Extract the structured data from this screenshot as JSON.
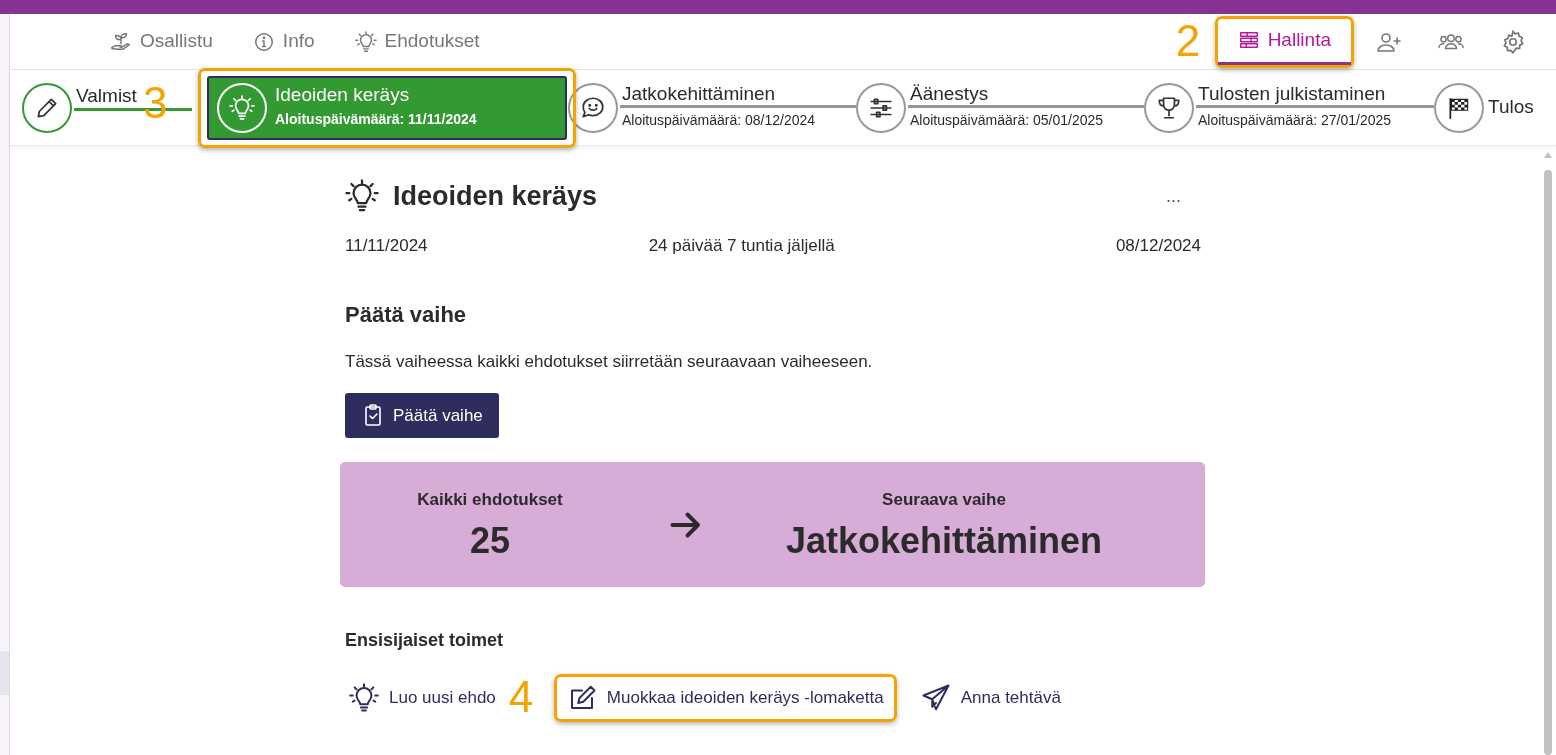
{
  "nav": {
    "items": [
      {
        "label": "Osallistu",
        "selected": false
      },
      {
        "label": "Info",
        "selected": false
      },
      {
        "label": "Ehdotukset",
        "selected": false
      }
    ],
    "admin": {
      "label": "Hallinta",
      "selected": true,
      "callout": "2"
    }
  },
  "steps": [
    {
      "title": "Valmist",
      "kind": "done"
    },
    {
      "title": "Ideoiden keräys",
      "subtitle": "Aloituspäivämäärä: 11/11/2024",
      "kind": "current",
      "callout": "3"
    },
    {
      "title": "Jatkokehittäminen",
      "subtitle": "Aloituspäivämäärä: 08/12/2024",
      "kind": "upcoming"
    },
    {
      "title": "Äänestys",
      "subtitle": "Aloituspäivämäärä: 05/01/2025",
      "kind": "upcoming"
    },
    {
      "title": "Tulosten julkistaminen",
      "subtitle": "Aloituspäivämäärä: 27/01/2025",
      "kind": "upcoming"
    },
    {
      "title": "Tulos",
      "kind": "last"
    }
  ],
  "phase": {
    "title": "Ideoiden keräys",
    "menu": "...",
    "start": "11/11/2024",
    "remaining": "24 päivää 7 tuntia jäljellä",
    "end": "08/12/2024"
  },
  "end_phase": {
    "heading": "Päätä vaihe",
    "text": "Tässä vaiheessa kaikki ehdotukset siirretään seuraavaan vaiheeseen.",
    "button": "Päätä vaihe"
  },
  "summary": {
    "left_label": "Kaikki ehdotukset",
    "left_value": "25",
    "right_label": "Seuraava vaihe",
    "right_value": "Jatkokehittäminen"
  },
  "actions": {
    "heading": "Ensisijaiset toimet",
    "items": [
      {
        "label": "Luo uusi ehdo"
      },
      {
        "label": "Muokkaa ideoiden keräys -lomaketta",
        "callout": "4"
      },
      {
        "label": "Anna tehtävä"
      }
    ]
  }
}
